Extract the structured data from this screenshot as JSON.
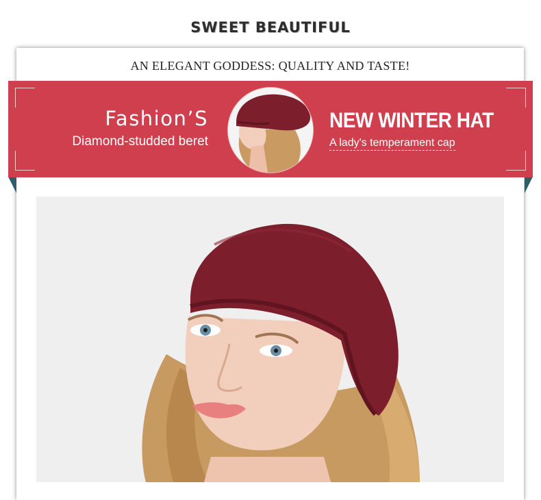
{
  "header": {
    "title": "SWEET BEAUTIFUL"
  },
  "tagline": "AN ELEGANT GODDESS: QUALITY AND TASTE!",
  "banner": {
    "left_title": "Fashion’S",
    "left_subtitle": "Diamond-studded beret",
    "right_title": "NEW WINTER HAT",
    "right_subtitle": "A lady's temperament cap",
    "color": "#cf3f4d",
    "fold_color": "#2e5e6c"
  },
  "images": {
    "thumbnail": "woman-in-burgundy-beret-side-view",
    "main": "woman-in-burgundy-beret-portrait"
  },
  "colors": {
    "beret": "#7d1e2c",
    "hair": "#c99a62",
    "skin": "#f2cfbc"
  }
}
